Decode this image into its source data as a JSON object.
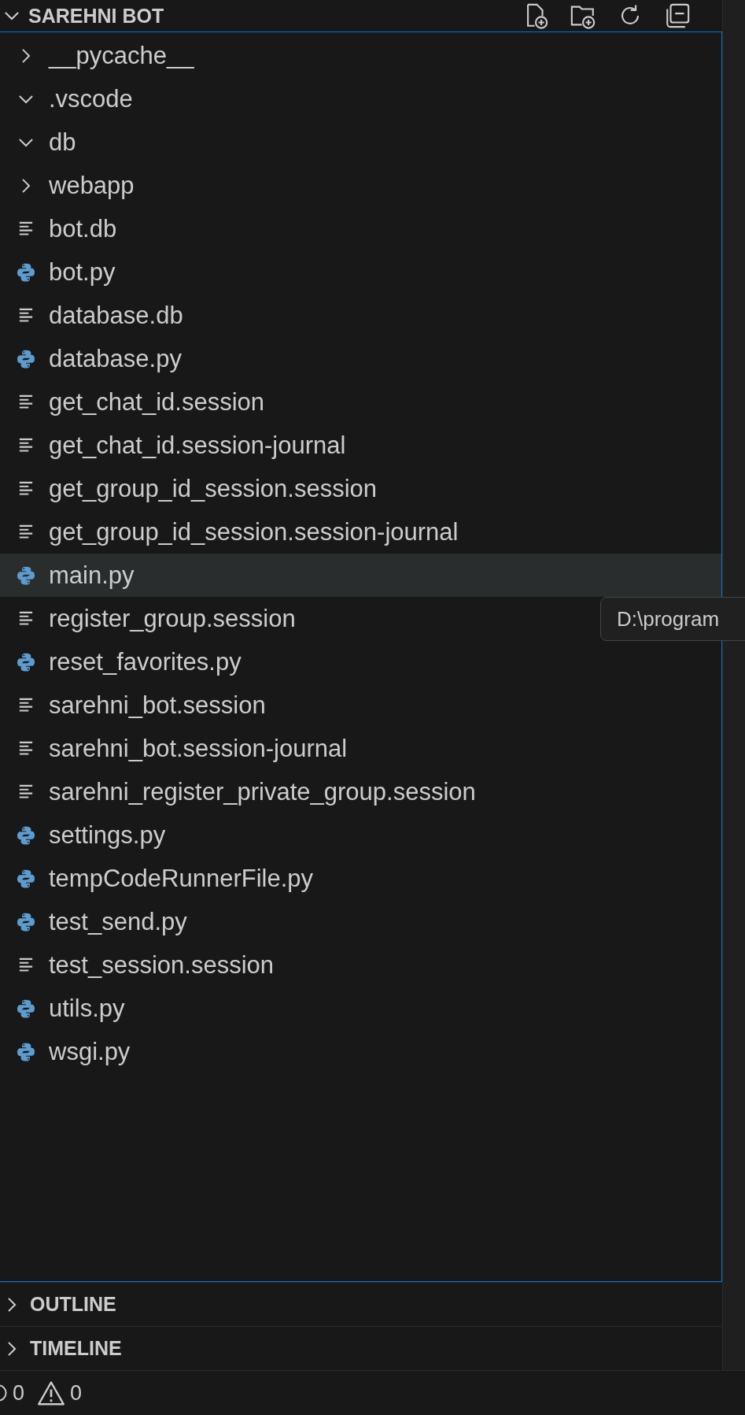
{
  "explorer": {
    "title": "SAREHNI BOT",
    "expanded": true,
    "items": [
      {
        "kind": "folder",
        "name": "__pycache__",
        "expanded": false,
        "selected": false
      },
      {
        "kind": "folder",
        "name": ".vscode",
        "expanded": true,
        "selected": false
      },
      {
        "kind": "folder",
        "name": "db",
        "expanded": true,
        "selected": false
      },
      {
        "kind": "folder",
        "name": "webapp",
        "expanded": false,
        "selected": false
      },
      {
        "kind": "text",
        "name": "bot.db",
        "selected": false
      },
      {
        "kind": "python",
        "name": "bot.py",
        "selected": false
      },
      {
        "kind": "text",
        "name": "database.db",
        "selected": false
      },
      {
        "kind": "python",
        "name": "database.py",
        "selected": false
      },
      {
        "kind": "text",
        "name": "get_chat_id.session",
        "selected": false
      },
      {
        "kind": "text",
        "name": "get_chat_id.session-journal",
        "selected": false
      },
      {
        "kind": "text",
        "name": "get_group_id_session.session",
        "selected": false
      },
      {
        "kind": "text",
        "name": "get_group_id_session.session-journal",
        "selected": false
      },
      {
        "kind": "python",
        "name": "main.py",
        "selected": true
      },
      {
        "kind": "text",
        "name": "register_group.session",
        "selected": false
      },
      {
        "kind": "python",
        "name": "reset_favorites.py",
        "selected": false
      },
      {
        "kind": "text",
        "name": "sarehni_bot.session",
        "selected": false
      },
      {
        "kind": "text",
        "name": "sarehni_bot.session-journal",
        "selected": false
      },
      {
        "kind": "text",
        "name": "sarehni_register_private_group.session",
        "selected": false
      },
      {
        "kind": "python",
        "name": "settings.py",
        "selected": false
      },
      {
        "kind": "python",
        "name": "tempCodeRunnerFile.py",
        "selected": false
      },
      {
        "kind": "python",
        "name": "test_send.py",
        "selected": false
      },
      {
        "kind": "text",
        "name": "test_session.session",
        "selected": false
      },
      {
        "kind": "python",
        "name": "utils.py",
        "selected": false
      },
      {
        "kind": "python",
        "name": "wsgi.py",
        "selected": false
      }
    ]
  },
  "tooltip": "D:\\program",
  "sections": [
    {
      "title": "OUTLINE",
      "expanded": false
    },
    {
      "title": "TIMELINE",
      "expanded": false
    }
  ],
  "status_bar": {
    "errors": "0",
    "warnings": "0"
  }
}
